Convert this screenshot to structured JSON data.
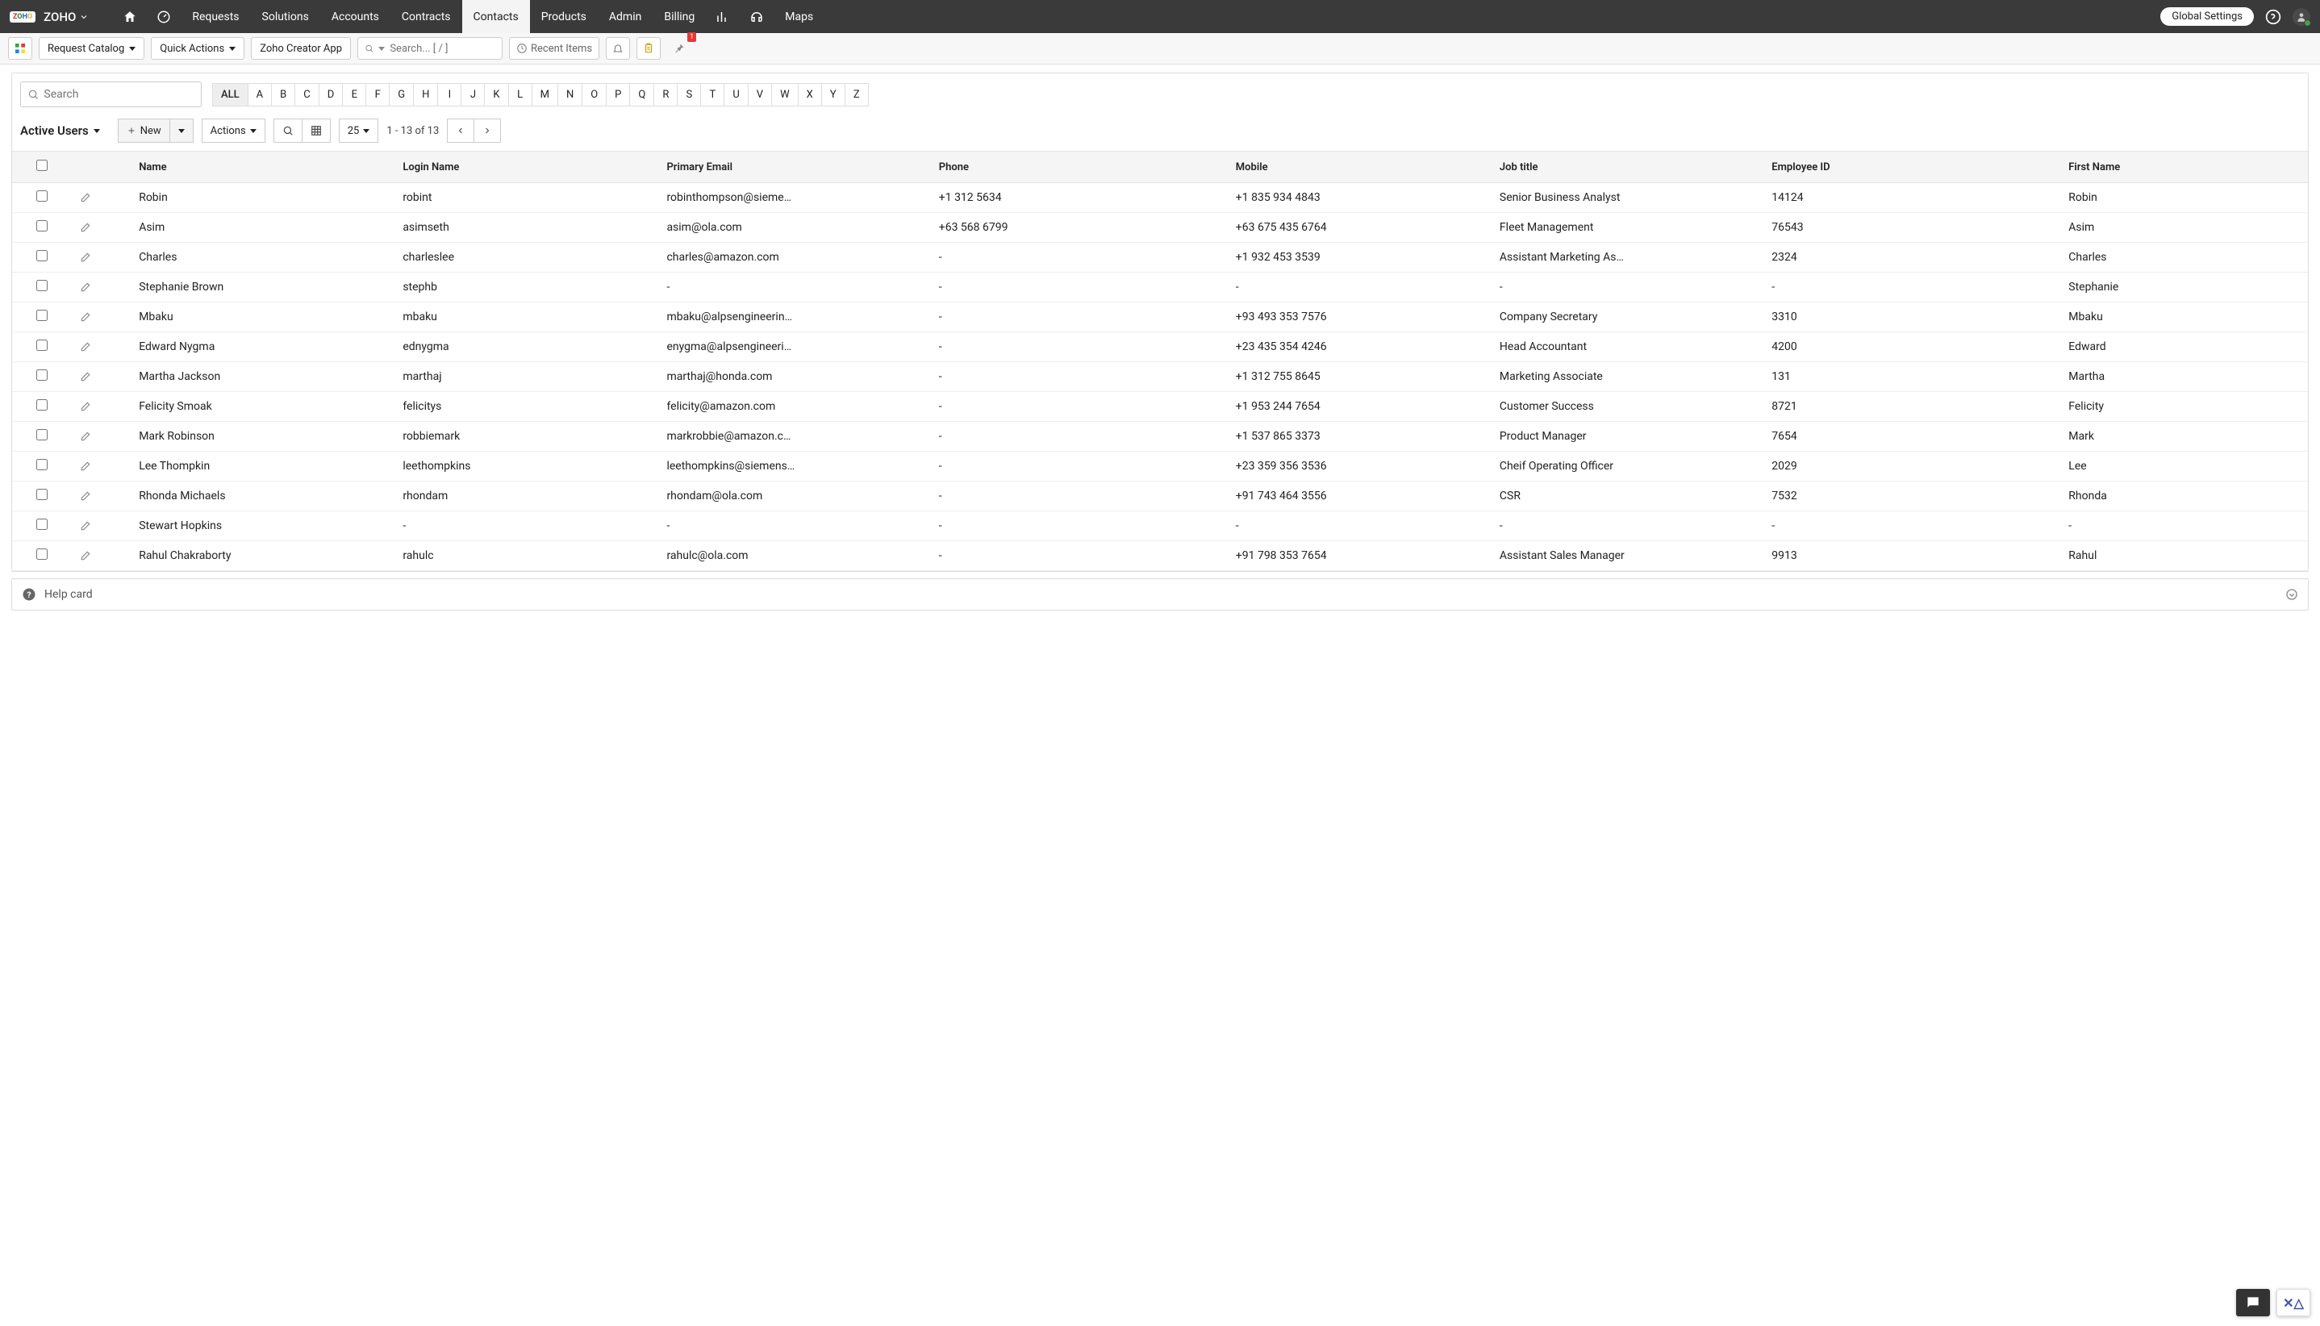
{
  "brand": "ZOHO",
  "nav": {
    "items": [
      "Requests",
      "Solutions",
      "Accounts",
      "Contracts",
      "Contacts",
      "Products",
      "Admin",
      "Billing",
      "Maps"
    ],
    "active": "Contacts"
  },
  "globalSettings": "Global Settings",
  "subbar": {
    "requestCatalog": "Request Catalog",
    "quickActions": "Quick Actions",
    "zohoCreator": "Zoho Creator App",
    "searchPlaceholder": "Search... [ / ]",
    "recentItems": "Recent Items",
    "pinBadge": "1"
  },
  "panel": {
    "localSearchPlaceholder": "Search",
    "alpha": [
      "ALL",
      "A",
      "B",
      "C",
      "D",
      "E",
      "F",
      "G",
      "H",
      "I",
      "J",
      "K",
      "L",
      "M",
      "N",
      "O",
      "P",
      "Q",
      "R",
      "S",
      "T",
      "U",
      "V",
      "W",
      "X",
      "Y",
      "Z"
    ],
    "alphaActive": "ALL",
    "viewTitle": "Active Users",
    "newLabel": "New",
    "actionsLabel": "Actions",
    "pageSize": "25",
    "pageInfo": "1 - 13 of 13"
  },
  "columns": [
    "Name",
    "Login Name",
    "Primary Email",
    "Phone",
    "Mobile",
    "Job title",
    "Employee ID",
    "First Name"
  ],
  "rows": [
    {
      "name": "Robin",
      "login": "robint",
      "email": "robinthompson@sieme…",
      "phone": "+1 312 5634",
      "mobile": "+1 835 934 4843",
      "job": "Senior Business Analyst",
      "eid": "14124",
      "first": "Robin"
    },
    {
      "name": "Asim",
      "login": "asimseth",
      "email": "asim@ola.com",
      "phone": "+63 568 6799",
      "mobile": "+63 675 435 6764",
      "job": "Fleet Management",
      "eid": "76543",
      "first": "Asim"
    },
    {
      "name": "Charles",
      "login": "charleslee",
      "email": "charles@amazon.com",
      "phone": "-",
      "mobile": "+1 932 453 3539",
      "job": "Assistant Marketing As…",
      "eid": "2324",
      "first": "Charles"
    },
    {
      "name": "Stephanie Brown",
      "login": "stephb",
      "email": "-",
      "phone": "-",
      "mobile": "-",
      "job": "-",
      "eid": "-",
      "first": "Stephanie"
    },
    {
      "name": "Mbaku",
      "login": "mbaku",
      "email": "mbaku@alpsengineerin…",
      "phone": "-",
      "mobile": "+93 493 353 7576",
      "job": "Company Secretary",
      "eid": "3310",
      "first": "Mbaku"
    },
    {
      "name": "Edward Nygma",
      "login": "ednygma",
      "email": "enygma@alpsengineeri…",
      "phone": "-",
      "mobile": "+23 435 354 4246",
      "job": "Head Accountant",
      "eid": "4200",
      "first": "Edward"
    },
    {
      "name": "Martha Jackson",
      "login": "marthaj",
      "email": "marthaj@honda.com",
      "phone": "-",
      "mobile": "+1 312 755 8645",
      "job": "Marketing Associate",
      "eid": "131",
      "first": "Martha"
    },
    {
      "name": "Felicity Smoak",
      "login": "felicitys",
      "email": "felicity@amazon.com",
      "phone": "-",
      "mobile": "+1 953 244 7654",
      "job": "Customer Success",
      "eid": "8721",
      "first": "Felicity"
    },
    {
      "name": "Mark Robinson",
      "login": "robbiemark",
      "email": "markrobbie@amazon.c…",
      "phone": "-",
      "mobile": "+1 537 865 3373",
      "job": "Product Manager",
      "eid": "7654",
      "first": "Mark"
    },
    {
      "name": "Lee Thompkin",
      "login": "leethompkins",
      "email": "leethompkins@siemens…",
      "phone": "-",
      "mobile": "+23 359 356 3536",
      "job": "Cheif Operating Officer",
      "eid": "2029",
      "first": "Lee"
    },
    {
      "name": "Rhonda Michaels",
      "login": "rhondam",
      "email": "rhondam@ola.com",
      "phone": "-",
      "mobile": "+91 743 464 3556",
      "job": "CSR",
      "eid": "7532",
      "first": "Rhonda"
    },
    {
      "name": "Stewart Hopkins",
      "login": "-",
      "email": "-",
      "phone": "-",
      "mobile": "-",
      "job": "-",
      "eid": "-",
      "first": "-"
    },
    {
      "name": "Rahul Chakraborty",
      "login": "rahulc",
      "email": "rahulc@ola.com",
      "phone": "-",
      "mobile": "+91 798 353 7654",
      "job": "Assistant Sales Manager",
      "eid": "9913",
      "first": "Rahul"
    }
  ],
  "helpCard": "Help card"
}
